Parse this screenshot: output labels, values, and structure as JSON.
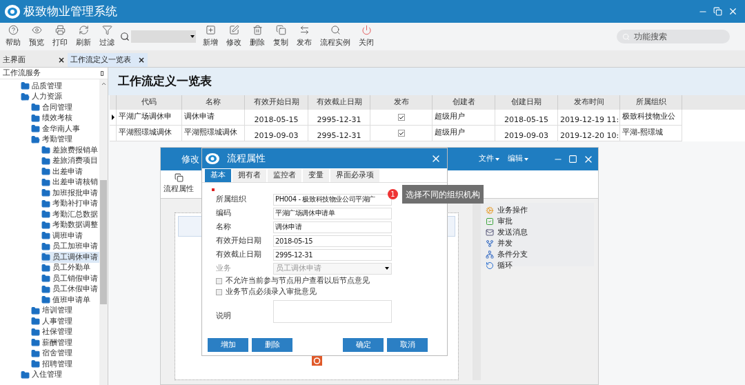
{
  "window": {
    "title": "极致物业管理系统"
  },
  "toolbar": {
    "left": [
      {
        "label": "帮助"
      },
      {
        "label": "预览"
      },
      {
        "label": "打印"
      },
      {
        "label": "刷新"
      },
      {
        "label": "过滤"
      }
    ],
    "right": [
      {
        "label": "新增"
      },
      {
        "label": "修改"
      },
      {
        "label": "删除"
      },
      {
        "label": "复制"
      },
      {
        "label": "发布"
      },
      {
        "label": "流程实例"
      },
      {
        "label": "关闭"
      }
    ],
    "search": {
      "placeholder": "功能搜索"
    }
  },
  "tabs": [
    {
      "label": "主界面",
      "selected": false,
      "close": "×"
    },
    {
      "label": "工作流定义一览表",
      "selected": true,
      "close": "×"
    }
  ],
  "sidebar": {
    "title": "工作流服务",
    "items": [
      {
        "label": "品质管理",
        "expanded": false,
        "selected": false
      },
      {
        "label": "人力资源",
        "expanded": true,
        "selected": false,
        "children": [
          {
            "label": "合同管理",
            "expanded": false,
            "selected": false
          },
          {
            "label": "绩效考核",
            "expanded": false,
            "selected": false
          },
          {
            "label": "金华南人事",
            "expanded": false,
            "selected": false
          },
          {
            "label": "考勤管理",
            "expanded": true,
            "selected": false,
            "children": [
              {
                "label": "差旅费报销单",
                "expanded": false,
                "selected": false
              },
              {
                "label": "差旅消费项目",
                "expanded": false,
                "selected": false
              },
              {
                "label": "出差申请",
                "expanded": false,
                "selected": false
              },
              {
                "label": "出差申请核销",
                "expanded": false,
                "selected": false
              },
              {
                "label": "加班报批申请",
                "expanded": false,
                "selected": false
              },
              {
                "label": "考勤补打申请",
                "expanded": false,
                "selected": false
              },
              {
                "label": "考勤汇总数据",
                "expanded": false,
                "selected": false
              },
              {
                "label": "考勤数据调整",
                "expanded": false,
                "selected": false
              },
              {
                "label": "调班申请",
                "expanded": false,
                "selected": false
              },
              {
                "label": "员工加班申请",
                "expanded": false,
                "selected": false
              },
              {
                "label": "员工调休申请",
                "expanded": false,
                "selected": true
              },
              {
                "label": "员工外勤单",
                "expanded": false,
                "selected": false
              },
              {
                "label": "员工销假申请",
                "expanded": false,
                "selected": false
              },
              {
                "label": "员工休假申请",
                "expanded": false,
                "selected": false
              },
              {
                "label": "值班申请单",
                "expanded": false,
                "selected": false
              }
            ]
          },
          {
            "label": "培训管理",
            "expanded": false,
            "selected": false
          },
          {
            "label": "人事管理",
            "expanded": false,
            "selected": false
          },
          {
            "label": "社保管理",
            "expanded": false,
            "selected": false
          },
          {
            "label": "薪酬管理",
            "expanded": false,
            "selected": false
          },
          {
            "label": "宿舍管理",
            "expanded": false,
            "selected": false
          },
          {
            "label": "招聘管理",
            "expanded": false,
            "selected": false
          }
        ]
      },
      {
        "label": "入住管理",
        "expanded": false,
        "selected": false
      }
    ]
  },
  "page_title": "工作流定义一览表",
  "table": {
    "columns": [
      "代码",
      "名称",
      "有效开始日期",
      "有效截止日期",
      "发布",
      "创建者",
      "创建日期",
      "发布时间",
      "所属组织"
    ],
    "rows": [
      {
        "selected": true,
        "cells": [
          "平湖广场调休申",
          "调休申请",
          "2018-05-15",
          "2995-12-31",
          {
            "checked": true
          },
          "超级用户",
          "2018-05-15",
          "2019-12-19 11:",
          "极致科技物业公"
        ]
      },
      {
        "selected": false,
        "cells": [
          "平湖熙璟城调休",
          "平湖熙璟城调休",
          "2019-09-03",
          "2995-12-31",
          {
            "checked": true
          },
          "超级用户",
          "2019-09-03",
          "2019-12-20 10:",
          "平湖-熙璟城"
        ]
      }
    ]
  },
  "designer": {
    "title": "修改",
    "menus": [
      "文件",
      "编辑"
    ],
    "tool": "流程属性",
    "palette": [
      {
        "label": "业务操作"
      },
      {
        "label": "审批"
      },
      {
        "label": "发送消息"
      },
      {
        "label": "并发"
      },
      {
        "label": "条件分支"
      },
      {
        "label": "循环"
      }
    ]
  },
  "dialog": {
    "title": "流程属性",
    "tabs": [
      {
        "label": "基本",
        "selected": true
      },
      {
        "label": "拥有者",
        "selected": false
      },
      {
        "label": "监控者",
        "selected": false
      },
      {
        "label": "变量",
        "selected": false
      },
      {
        "label": "界面必录项",
        "selected": false
      }
    ],
    "fields": [
      {
        "label": "所属组织",
        "value": "PH004 - 极致科技物业公司平湖广",
        "kind": "text",
        "disabled": false
      },
      {
        "label": "编码",
        "value": "平湖广场调休申请单",
        "kind": "text",
        "disabled": false
      },
      {
        "label": "名称",
        "value": "调休申请",
        "kind": "text",
        "disabled": false
      },
      {
        "label": "有效开始日期",
        "value": "2018-05-15",
        "kind": "text",
        "disabled": false
      },
      {
        "label": "有效截止日期",
        "value": "2995-12-31",
        "kind": "text",
        "disabled": false
      },
      {
        "label": "业务",
        "value": "员工调休申请",
        "kind": "select",
        "disabled": true
      }
    ],
    "checks": [
      {
        "label": "不允许当前参与节点用户查看以后节点意见",
        "checked": false
      },
      {
        "label": "业务节点必须录入审批意见",
        "checked": false
      }
    ],
    "note_label": "说明",
    "buttons_left": [
      "增加",
      "删除"
    ],
    "buttons_right": [
      "确定",
      "取消"
    ]
  },
  "hint": {
    "badge": "1",
    "text": "选择不同的组织机构"
  }
}
